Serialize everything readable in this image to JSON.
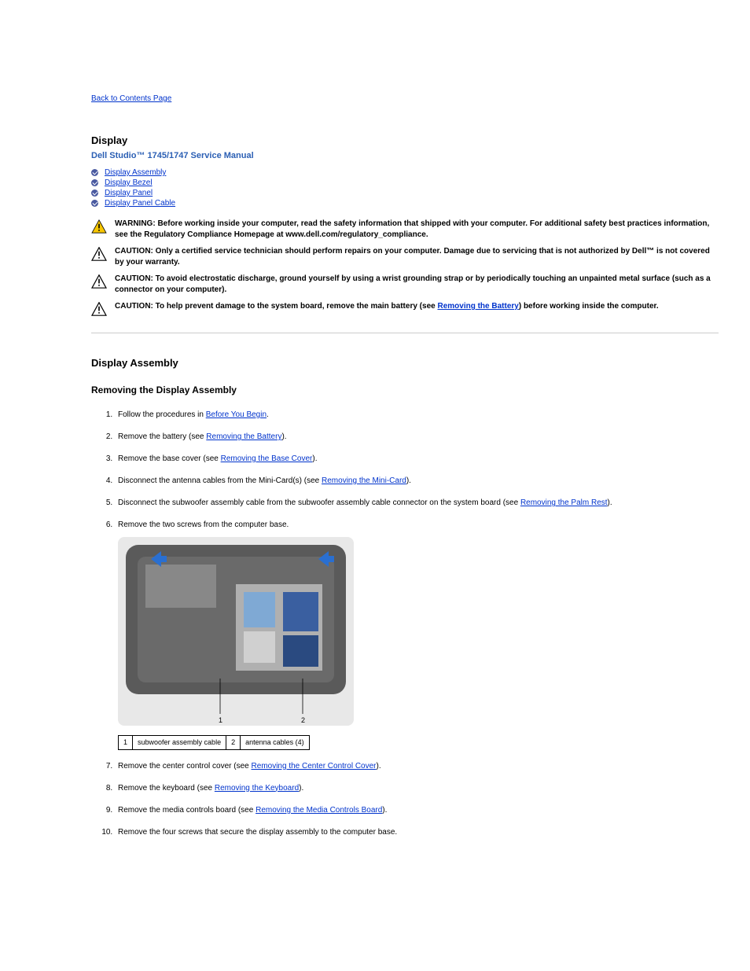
{
  "back_link": "Back to Contents Page",
  "section_title": "Display",
  "manual_title": "Dell Studio™ 1745/1747 Service Manual",
  "toc": [
    {
      "label": "Display Assembly"
    },
    {
      "label": "Display Bezel"
    },
    {
      "label": "Display Panel"
    },
    {
      "label": "Display Panel Cable"
    }
  ],
  "warnings": [
    {
      "type": "warning",
      "lead": "WARNING:",
      "text": "Before working inside your computer, read the safety information that shipped with your computer. For additional safety best practices information, see the Regulatory Compliance Homepage at www.dell.com/regulatory_compliance."
    },
    {
      "type": "caution",
      "lead": "CAUTION:",
      "text": "Only a certified service technician should perform repairs on your computer. Damage due to servicing that is not authorized by Dell™ is not covered by your warranty."
    },
    {
      "type": "caution",
      "lead": "CAUTION:",
      "text": "To avoid electrostatic discharge, ground yourself by using a wrist grounding strap or by periodically touching an unpainted metal surface (such as a connector on your computer)."
    },
    {
      "type": "caution",
      "lead": "CAUTION:",
      "text_pre": "To help prevent damage to the system board, remove the main battery (see ",
      "link": "Removing the Battery",
      "text_post": ") before working inside the computer."
    }
  ],
  "h2": "Display Assembly",
  "h3": "Removing the Display Assembly",
  "steps": [
    {
      "pre": "Follow the procedures in ",
      "link": "Before You Begin",
      "post": "."
    },
    {
      "pre": "Remove the battery (see ",
      "link": "Removing the Battery",
      "post": ")."
    },
    {
      "pre": "Remove the base cover (see ",
      "link": "Removing the Base Cover",
      "post": ")."
    },
    {
      "pre": "Disconnect the antenna cables from the Mini-Card(s) (see ",
      "link": "Removing the Mini-Card",
      "post": ")."
    },
    {
      "pre": "Disconnect the subwoofer assembly cable from the subwoofer assembly cable connector on the system board (see ",
      "link": "Removing the Palm Rest",
      "post": ")."
    },
    {
      "pre": "Remove the two screws from the computer base.",
      "link": null,
      "post": ""
    },
    {
      "pre": "Remove the center control cover (see ",
      "link": "Removing the Center Control Cover",
      "post": ")."
    },
    {
      "pre": "Remove the keyboard (see ",
      "link": "Removing the Keyboard",
      "post": ")."
    },
    {
      "pre": "Remove the media controls board (see ",
      "link": "Removing the Media Controls Board",
      "post": ")."
    },
    {
      "pre": "Remove the four screws that secure the display assembly to the computer base.",
      "link": null,
      "post": ""
    }
  ],
  "label_table": {
    "row": [
      {
        "num": "1",
        "label": "subwoofer assembly cable"
      },
      {
        "num": "2",
        "label": "antenna cables (4)"
      }
    ]
  },
  "figure_alt": "Computer base bottom view"
}
